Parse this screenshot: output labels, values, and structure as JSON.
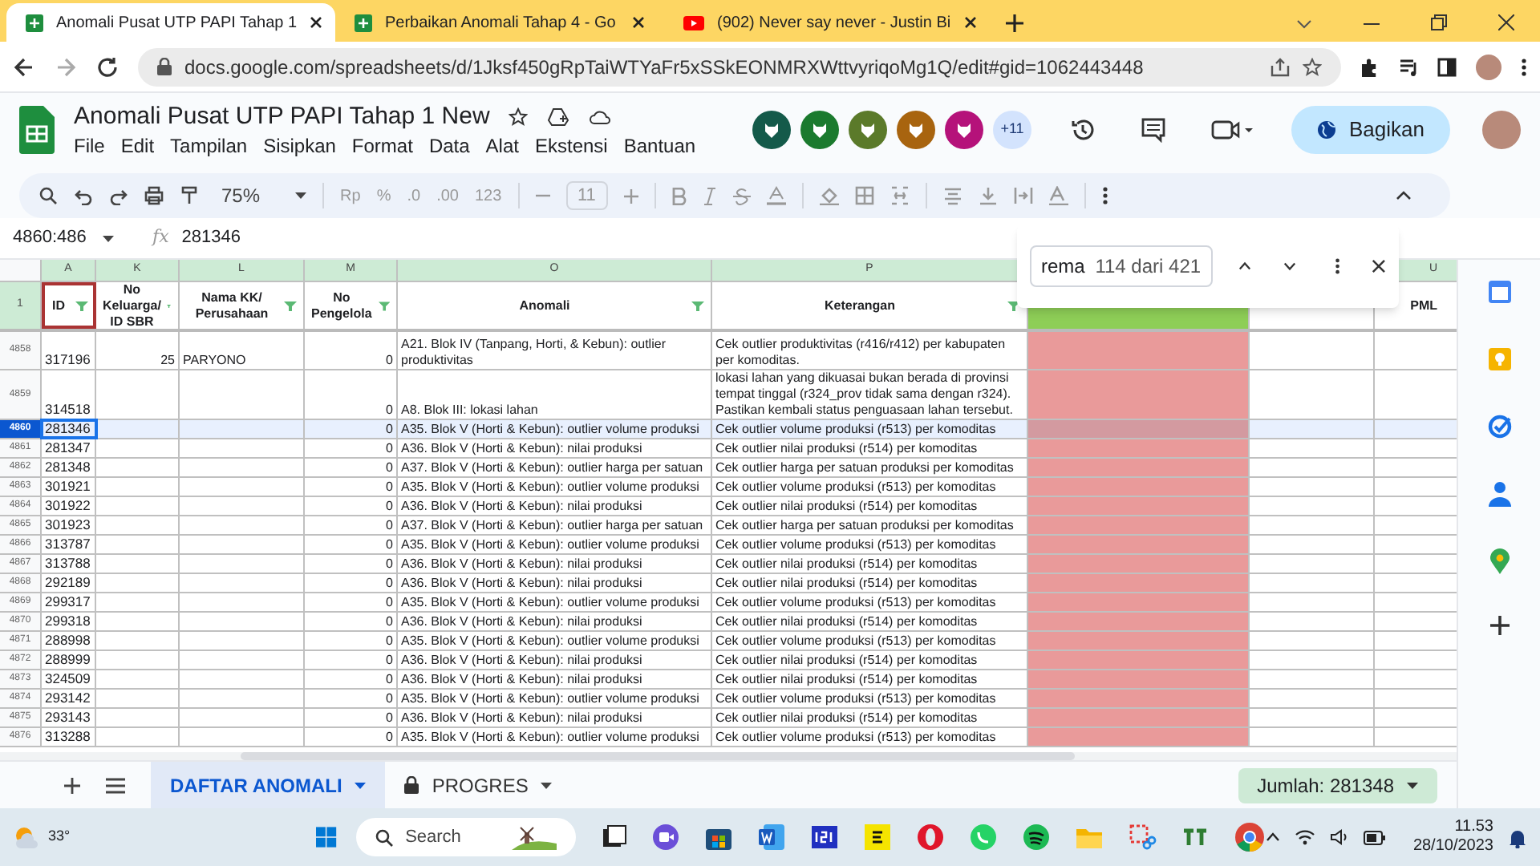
{
  "browser": {
    "tabs": [
      {
        "title": "Anomali Pusat UTP PAPI Tahap 1",
        "kind": "sheets",
        "selected": true
      },
      {
        "title": "Perbaikan Anomali Tahap 4 - Go",
        "kind": "sheets",
        "selected": false
      },
      {
        "title": "(902) Never say never - Justin Bi",
        "kind": "youtube",
        "selected": false
      }
    ],
    "url": "docs.google.com/spreadsheets/d/1Jksf450gRpTaiWTYaFr5xSSkEONMRXWttvyriqoMg1Q/edit#gid=1062443448"
  },
  "doc": {
    "title": "Anomali Pusat UTP PAPI Tahap 1 New",
    "menu": [
      "File",
      "Edit",
      "Tampilan",
      "Sisipkan",
      "Format",
      "Data",
      "Alat",
      "Ekstensi",
      "Bantuan"
    ],
    "collaborators": [
      {
        "color": "#145a4a"
      },
      {
        "color": "#1b7a2e"
      },
      {
        "color": "#5b7a2a"
      },
      {
        "color": "#a8640f"
      },
      {
        "color": "#b5127a"
      }
    ],
    "more_collaborators": "+11",
    "share": "Bagikan"
  },
  "toolbar": {
    "zoom": "75%",
    "format_items": [
      "Rp",
      "%",
      ".0",
      ".00",
      "123"
    ],
    "font_size": "11"
  },
  "formula_bar": {
    "name_box": "4860:486",
    "fx": "fx",
    "formula": "281346"
  },
  "columns": [
    {
      "letter": "A",
      "title": "ID"
    },
    {
      "letter": "K",
      "title": "No Keluarga/ ID SBR"
    },
    {
      "letter": "L",
      "title": "Nama KK/ Perusahaan"
    },
    {
      "letter": "M",
      "title": "No Pengelola"
    },
    {
      "letter": "O",
      "title": "Anomali"
    },
    {
      "letter": "P",
      "title": "Keterangan"
    },
    {},
    {},
    {
      "letter": "U",
      "title": "PML"
    }
  ],
  "header_row": "1",
  "rows": [
    {
      "num": "4858",
      "id": "317196",
      "k": "25",
      "l": "PARYONO",
      "m": "0",
      "anomali": "A21. Blok IV (Tanpang, Horti, & Kebun): outlier produktivitas",
      "keterangan": "Cek outlier produktivitas (r416/r412) per kabupaten per komoditas.",
      "selected": false
    },
    {
      "num": "4859",
      "id": "314518",
      "k": "",
      "l": "",
      "m": "0",
      "anomali": "A8. Blok III: lokasi lahan",
      "keterangan": "lokasi lahan yang dikuasai bukan berada di provinsi tempat tinggal (r324_prov tidak sama dengan r324). Pastikan kembali status penguasaan lahan tersebut.",
      "selected": false
    },
    {
      "num": "4860",
      "id": "281346",
      "k": "",
      "l": "",
      "m": "0",
      "anomali": "A35. Blok V (Horti & Kebun): outlier volume produksi",
      "keterangan": "Cek outlier volume produksi (r513) per komoditas",
      "selected": true
    },
    {
      "num": "4861",
      "id": "281347",
      "k": "",
      "l": "",
      "m": "0",
      "anomali": "A36. Blok V (Horti & Kebun): nilai produksi",
      "keterangan": "Cek outlier nilai produksi (r514) per komoditas",
      "selected": false
    },
    {
      "num": "4862",
      "id": "281348",
      "k": "",
      "l": "",
      "m": "0",
      "anomali": "A37. Blok V (Horti & Kebun): outlier harga per satuan",
      "keterangan": "Cek outlier harga per satuan produksi per komoditas",
      "selected": false
    },
    {
      "num": "4863",
      "id": "301921",
      "k": "",
      "l": "",
      "m": "0",
      "anomali": "A35. Blok V (Horti & Kebun): outlier volume produksi",
      "keterangan": "Cek outlier volume produksi (r513) per komoditas",
      "selected": false
    },
    {
      "num": "4864",
      "id": "301922",
      "k": "",
      "l": "",
      "m": "0",
      "anomali": "A36. Blok V (Horti & Kebun): nilai produksi",
      "keterangan": "Cek outlier nilai produksi (r514) per komoditas",
      "selected": false
    },
    {
      "num": "4865",
      "id": "301923",
      "k": "",
      "l": "",
      "m": "0",
      "anomali": "A37. Blok V (Horti & Kebun): outlier harga per satuan",
      "keterangan": "Cek outlier harga per satuan produksi per komoditas",
      "selected": false
    },
    {
      "num": "4866",
      "id": "313787",
      "k": "",
      "l": "",
      "m": "0",
      "anomali": "A35. Blok V (Horti & Kebun): outlier volume produksi",
      "keterangan": "Cek outlier volume produksi (r513) per komoditas",
      "selected": false
    },
    {
      "num": "4867",
      "id": "313788",
      "k": "",
      "l": "",
      "m": "0",
      "anomali": "A36. Blok V (Horti & Kebun): nilai produksi",
      "keterangan": "Cek outlier nilai produksi (r514) per komoditas",
      "selected": false
    },
    {
      "num": "4868",
      "id": "292189",
      "k": "",
      "l": "",
      "m": "0",
      "anomali": "A36. Blok V (Horti & Kebun): nilai produksi",
      "keterangan": "Cek outlier nilai produksi (r514) per komoditas",
      "selected": false
    },
    {
      "num": "4869",
      "id": "299317",
      "k": "",
      "l": "",
      "m": "0",
      "anomali": "A35. Blok V (Horti & Kebun): outlier volume produksi",
      "keterangan": "Cek outlier volume produksi (r513) per komoditas",
      "selected": false
    },
    {
      "num": "4870",
      "id": "299318",
      "k": "",
      "l": "",
      "m": "0",
      "anomali": "A36. Blok V (Horti & Kebun): nilai produksi",
      "keterangan": "Cek outlier nilai produksi (r514) per komoditas",
      "selected": false
    },
    {
      "num": "4871",
      "id": "288998",
      "k": "",
      "l": "",
      "m": "0",
      "anomali": "A35. Blok V (Horti & Kebun): outlier volume produksi",
      "keterangan": "Cek outlier volume produksi (r513) per komoditas",
      "selected": false
    },
    {
      "num": "4872",
      "id": "288999",
      "k": "",
      "l": "",
      "m": "0",
      "anomali": "A36. Blok V (Horti & Kebun): nilai produksi",
      "keterangan": "Cek outlier nilai produksi (r514) per komoditas",
      "selected": false
    },
    {
      "num": "4873",
      "id": "324509",
      "k": "",
      "l": "",
      "m": "0",
      "anomali": "A36. Blok V (Horti & Kebun): nilai produksi",
      "keterangan": "Cek outlier nilai produksi (r514) per komoditas",
      "selected": false
    },
    {
      "num": "4874",
      "id": "293142",
      "k": "",
      "l": "",
      "m": "0",
      "anomali": "A35. Blok V (Horti & Kebun): outlier volume produksi",
      "keterangan": "Cek outlier volume produksi (r513) per komoditas",
      "selected": false
    },
    {
      "num": "4875",
      "id": "293143",
      "k": "",
      "l": "",
      "m": "0",
      "anomali": "A36. Blok V (Horti & Kebun): nilai produksi",
      "keterangan": "Cek outlier nilai produksi (r514) per komoditas",
      "selected": false
    },
    {
      "num": "4876",
      "id": "313288",
      "k": "",
      "l": "",
      "m": "0",
      "anomali": "A35. Blok V (Horti & Kebun): outlier volume produksi",
      "keterangan": "Cek outlier volume produksi (r513) per komoditas",
      "selected": false
    }
  ],
  "find_bar": {
    "query": "rema",
    "count": "114 dari 421"
  },
  "sheets": [
    {
      "label": "DAFTAR ANOMALI",
      "locked": false,
      "selected": true
    },
    {
      "label": "PROGRES",
      "locked": true,
      "selected": false
    }
  ],
  "sum": "Jumlah: 281348",
  "taskbar": {
    "weather": "33°",
    "search": "Search",
    "time": "11.53",
    "date": "28/10/2023"
  }
}
